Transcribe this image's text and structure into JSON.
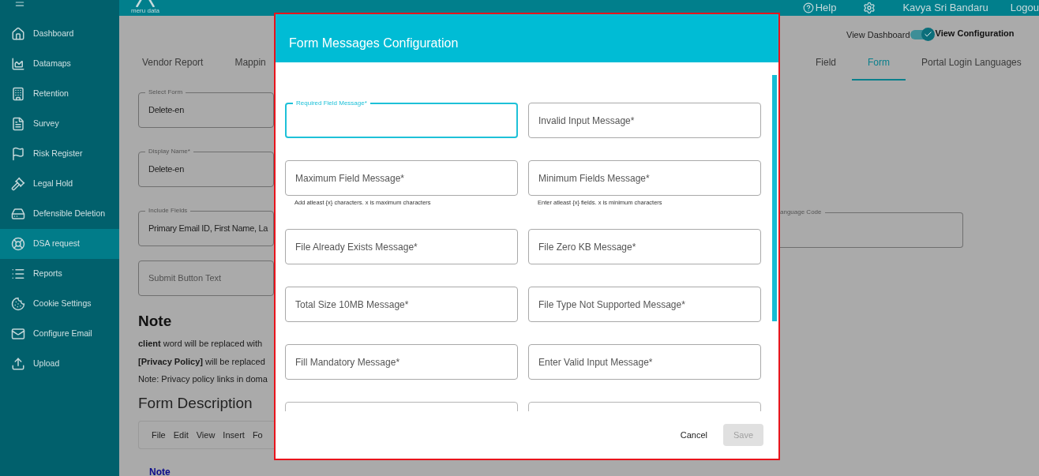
{
  "header": {
    "logo_text": "meru data",
    "help": "Help",
    "user": "Kavya Sri Bandaru",
    "logout": "Logou"
  },
  "sidebar": {
    "items": [
      {
        "label": "Dashboard",
        "selected": false
      },
      {
        "label": "Datamaps",
        "selected": false
      },
      {
        "label": "Retention",
        "selected": false
      },
      {
        "label": "Survey",
        "selected": false
      },
      {
        "label": "Risk Register",
        "selected": false
      },
      {
        "label": "Legal Hold",
        "selected": false
      },
      {
        "label": "Defensible Deletion",
        "selected": false
      },
      {
        "label": "DSA request",
        "selected": true
      },
      {
        "label": "Reports",
        "selected": false
      },
      {
        "label": "Cookie Settings",
        "selected": false
      },
      {
        "label": "Configure Email",
        "selected": false
      },
      {
        "label": "Upload",
        "selected": false
      }
    ]
  },
  "view_toggle": {
    "left_label": "View Dashboard",
    "right_label": "View Configuration",
    "on": true
  },
  "tabs_left": [
    {
      "label": "Vendor Report",
      "selected": false
    },
    {
      "label": "Mappin",
      "selected": false
    }
  ],
  "tabs_right": [
    {
      "label": "Field",
      "selected": false
    },
    {
      "label": "Form",
      "selected": true
    },
    {
      "label": "Portal Login Languages",
      "selected": false
    }
  ],
  "form": {
    "fields": [
      {
        "label": "Select Form",
        "value": "Delete-en"
      },
      {
        "label": "Display Name*",
        "value": "Delete-en"
      },
      {
        "label": "Include Fields",
        "value": "Primary Email ID, First Name, La"
      }
    ],
    "submit_field": {
      "placeholder": "Submit Button Text"
    },
    "language_field": {
      "label": "anguage Code"
    }
  },
  "note": {
    "heading": "Note",
    "lines": [
      "**client** word will be replaced with",
      "**[Privacy Policy]** will be replaced",
      "Note: Privacy policy links in doma"
    ]
  },
  "form_description": {
    "heading": "Form Description",
    "menu": [
      "File",
      "Edit",
      "View",
      "Insert",
      "Fo"
    ],
    "link": "Note"
  },
  "modal": {
    "title": "Form Messages Configuration",
    "fields": [
      {
        "kind": "text",
        "label": "Required Field Message*",
        "focused": true
      },
      {
        "kind": "text",
        "label": "Invalid Input Message*",
        "focused": false
      },
      {
        "kind": "text",
        "label": "Maximum Field Message*",
        "focused": false,
        "helper": "Add atleast {x} characters. x is maximum characters"
      },
      {
        "kind": "text",
        "label": "Minimum Fields Message*",
        "focused": false,
        "helper": "Enter atleast {x} fields. x is minimum characters"
      },
      {
        "kind": "text",
        "label": "File Already Exists Message*",
        "focused": false
      },
      {
        "kind": "text",
        "label": "File Zero KB Message*",
        "focused": false
      },
      {
        "kind": "text",
        "label": "Total Size 10MB Message*",
        "focused": false
      },
      {
        "kind": "text",
        "label": "File Type Not Supported Message*",
        "focused": false
      },
      {
        "kind": "text",
        "label": "Fill Mandatory Message*",
        "focused": false
      },
      {
        "kind": "text",
        "label": "Enter Valid Input Message*",
        "focused": false
      },
      {
        "kind": "partial"
      },
      {
        "kind": "partial"
      }
    ],
    "cancel": "Cancel",
    "save": {
      "label": "Save",
      "disabled": true
    }
  }
}
